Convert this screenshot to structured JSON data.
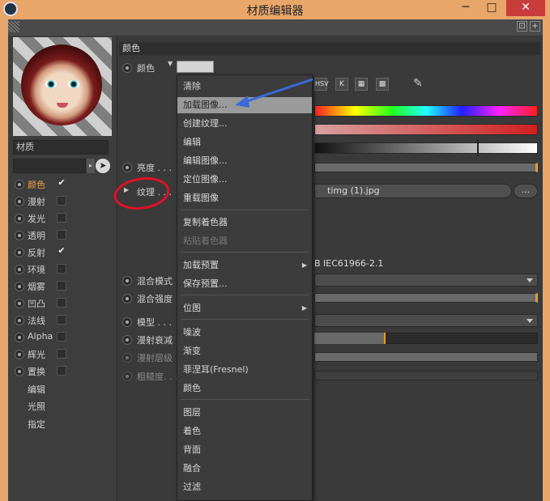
{
  "window": {
    "title": "材质编辑器",
    "minimize": "─",
    "maximize": "□",
    "close": "✕"
  },
  "toolbar": {
    "icons": [
      "lock-icon",
      "new-window-icon"
    ],
    "lock_glyph": "⊡",
    "new_glyph": "+"
  },
  "left_panel": {
    "material_name": "材质",
    "picker_glyph": "➤",
    "dropdown_glyph": "▸",
    "channels": [
      {
        "label": "颜色",
        "checked": true,
        "active": true
      },
      {
        "label": "漫射",
        "checked": false
      },
      {
        "label": "发光",
        "checked": false
      },
      {
        "label": "透明",
        "checked": false
      },
      {
        "label": "反射",
        "checked": true
      },
      {
        "label": "环境",
        "checked": false
      },
      {
        "label": "烟雾",
        "checked": false
      },
      {
        "label": "凹凸",
        "checked": false
      },
      {
        "label": "法线",
        "checked": false
      },
      {
        "label": "Alpha",
        "checked": false
      },
      {
        "label": "辉光",
        "checked": false
      },
      {
        "label": "置换",
        "checked": false
      }
    ],
    "check_glyph": "✔",
    "links": [
      "编辑",
      "光照",
      "指定"
    ]
  },
  "right_panel": {
    "section_title": "颜色",
    "color_label": "颜色",
    "brightness_label": "亮度 . . .",
    "texture_label": "纹理 . . .",
    "texture_file": "timg (1).jpg",
    "texture_more": "...",
    "color_modes": [
      "HSV",
      "K"
    ],
    "profile": "B IEC61966-2.1",
    "blend_mode_label": "混合模式",
    "blend_strength_label": "混合强度",
    "model_label": "模型 . . .",
    "diffuse_falloff_label": "漫射衰减",
    "diffuse_level_label": "漫射层级",
    "roughness_label": "粗糙度. . ."
  },
  "context_menu": {
    "items": [
      {
        "label": "清除"
      },
      {
        "label": "加载图像...",
        "highlighted": true
      },
      {
        "label": "创建纹理..."
      },
      {
        "label": "编辑"
      },
      {
        "label": "编辑图像..."
      },
      {
        "label": "定位图像..."
      },
      {
        "label": "重载图像"
      },
      {
        "label": "复制着色器"
      },
      {
        "label": "粘贴着色器",
        "disabled": true
      },
      {
        "label": "加载预置",
        "submenu": true
      },
      {
        "label": "保存预置..."
      },
      {
        "label": "位图",
        "submenu": true
      },
      {
        "label": "噪波"
      },
      {
        "label": "渐变"
      },
      {
        "label": "菲涅耳(Fresnel)"
      },
      {
        "label": "颜色"
      },
      {
        "label": "图层"
      },
      {
        "label": "着色"
      },
      {
        "label": "背面"
      },
      {
        "label": "融合"
      },
      {
        "label": "过滤"
      }
    ],
    "submenu_glyph": "▶"
  },
  "colors": {
    "title_bar": "#e8a66a",
    "close_button": "#c83c3c",
    "highlight": "#9a9a9a",
    "accent_orange": "#e89a2a",
    "annotation_red": "#e0102a",
    "annotation_blue": "#3a6ad8"
  }
}
